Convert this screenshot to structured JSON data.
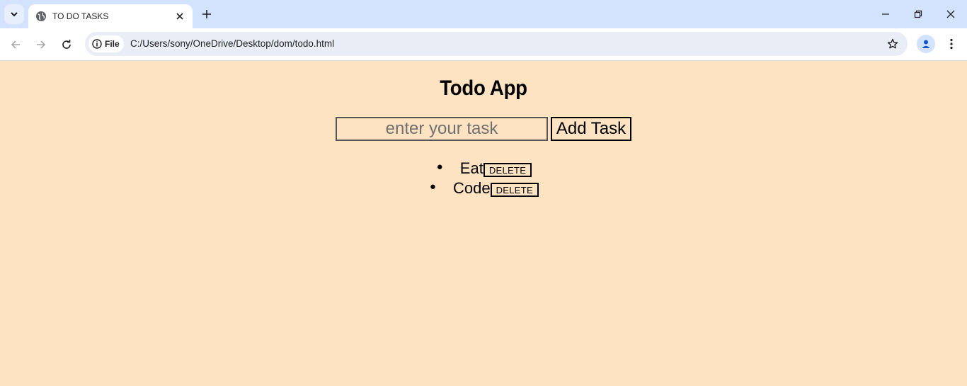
{
  "browser": {
    "tab_title": "TO DO TASKS",
    "address_chip": "File",
    "url": "C:/Users/sony/OneDrive/Desktop/dom/todo.html"
  },
  "page": {
    "heading": "Todo App",
    "input_placeholder": "enter your task",
    "add_button": "Add Task",
    "tasks": [
      {
        "text": "Eat",
        "delete_label": "DELETE"
      },
      {
        "text": "Code",
        "delete_label": "DELETE"
      }
    ],
    "background_color": "#fde3c2"
  }
}
